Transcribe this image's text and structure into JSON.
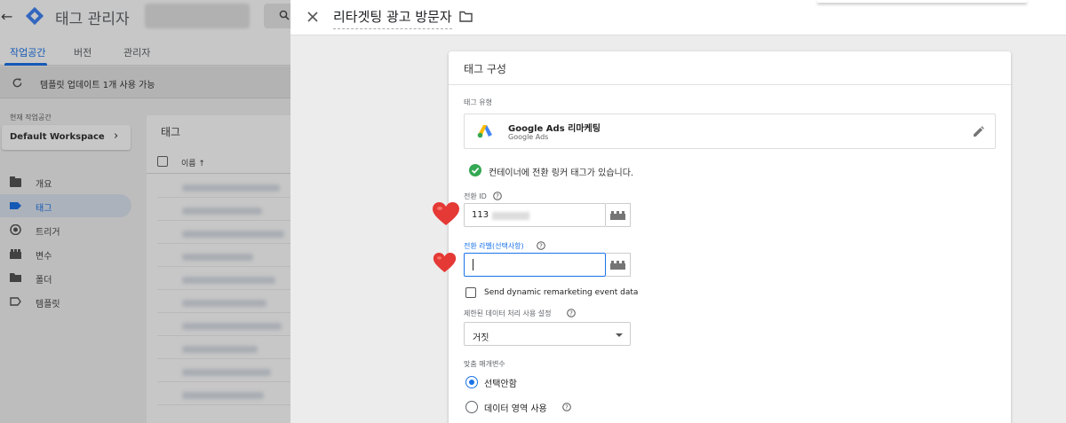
{
  "app": {
    "title": "태그 관리자",
    "back_icon": "arrow-left-icon",
    "logo_icon": "gtm-diamond-logo",
    "search_icon": "search-icon"
  },
  "tabs": [
    {
      "label": "작업공간",
      "active": true
    },
    {
      "label": "버전",
      "active": false
    },
    {
      "label": "관리자",
      "active": false
    }
  ],
  "notice": {
    "text": "템플릿 업데이트 1개 사용 가능",
    "icon": "refresh-icon"
  },
  "workspace": {
    "label": "현재 작업공간",
    "name": "Default Workspace",
    "chevron": "chevron-right-icon"
  },
  "nav": [
    {
      "label": "개요",
      "icon": "folder-icon",
      "active": false
    },
    {
      "label": "태그",
      "icon": "tag-icon",
      "active": true
    },
    {
      "label": "트리거",
      "icon": "trigger-icon",
      "active": false
    },
    {
      "label": "변수",
      "icon": "variable-icon",
      "active": false
    },
    {
      "label": "폴더",
      "icon": "folder-icon",
      "active": false
    },
    {
      "label": "템플릿",
      "icon": "template-icon",
      "active": false
    }
  ],
  "tag_list": {
    "title": "태그",
    "column_name": "이름 ↑"
  },
  "sheet": {
    "tag_name": "리타겟팅 광고 방문자",
    "close_icon": "close-icon",
    "folder_icon": "folder-icon"
  },
  "tag_config": {
    "title": "태그 구성",
    "type_label": "태그 유형",
    "type_name": "Google Ads 리마케팅",
    "type_sub": "Google Ads",
    "conversion_linker_msg": "컨테이너에 전환 링커 태그가 있습니다.",
    "conversion_id_label": "전환 ID",
    "conversion_id_value": "113",
    "conversion_label_label": "전환 라벨(선택사항)",
    "conversion_label_value": "",
    "dynamic_checkbox_label": "Send dynamic remarketing event data",
    "dynamic_checked": false,
    "restricted_label": "제한된 데이터 처리 사용 설정",
    "restricted_value": "거짓",
    "custom_params_label": "맞춤 매개변수",
    "radio_options": [
      {
        "label": "선택안함",
        "selected": true
      },
      {
        "label": "데이터 영역 사용",
        "selected": false
      }
    ]
  },
  "colors": {
    "accent": "#1a73e8",
    "success": "#34a853",
    "heart": "#e53935"
  }
}
